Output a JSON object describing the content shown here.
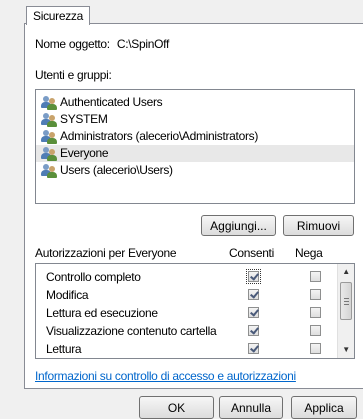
{
  "tab": {
    "label": "Sicurezza"
  },
  "object": {
    "label": "Nome oggetto:",
    "value": "C:\\SpinOff"
  },
  "groups": {
    "label": "Utenti e gruppi:",
    "items": [
      {
        "name": "Authenticated Users",
        "selected": false
      },
      {
        "name": "SYSTEM",
        "selected": false
      },
      {
        "name": "Administrators (alecerio\\Administrators)",
        "selected": false
      },
      {
        "name": "Everyone",
        "selected": true
      },
      {
        "name": "Users (alecerio\\Users)",
        "selected": false
      }
    ],
    "add_button": "Aggiungi...",
    "remove_button": "Rimuovi"
  },
  "permissions": {
    "header": "Autorizzazioni per Everyone",
    "allow_header": "Consenti",
    "deny_header": "Nega",
    "rows": [
      {
        "label": "Controllo completo",
        "allow": true,
        "deny": false
      },
      {
        "label": "Modifica",
        "allow": true,
        "deny": false
      },
      {
        "label": "Lettura ed esecuzione",
        "allow": true,
        "deny": false
      },
      {
        "label": "Visualizzazione contenuto cartella",
        "allow": true,
        "deny": false
      },
      {
        "label": "Lettura",
        "allow": true,
        "deny": false
      }
    ]
  },
  "link": "Informazioni su controllo di accesso e autorizzazioni",
  "footer": {
    "ok": "OK",
    "cancel": "Annulla",
    "apply": "Applica"
  }
}
